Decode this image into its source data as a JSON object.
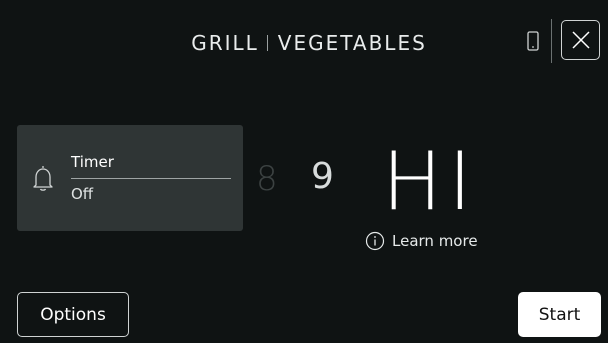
{
  "header": {
    "mode": "GRILL",
    "food": "VEGETABLES",
    "phone_icon": "phone-icon",
    "close_icon": "close-icon"
  },
  "timer": {
    "icon": "bell-icon",
    "label": "Timer",
    "value": "Off"
  },
  "level_picker": {
    "levels_visible": [
      "8",
      "9",
      "HI"
    ],
    "selected": "HI",
    "learn_more_icon": "info-icon",
    "learn_more_label": "Learn more"
  },
  "footer": {
    "options_label": "Options",
    "start_label": "Start"
  },
  "colors": {
    "background": "#0f1313",
    "card": "#2f3535",
    "text": "#ffffff",
    "primary_button": "#ffffff"
  }
}
